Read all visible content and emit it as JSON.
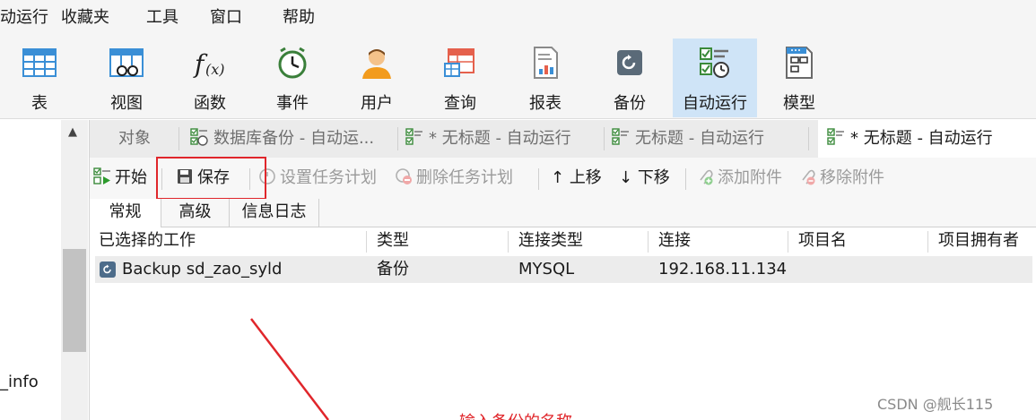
{
  "menu": [
    "动运行",
    "收藏夹",
    "工具",
    "窗口",
    "帮助"
  ],
  "toolbar": [
    {
      "label": "表",
      "icon": "table-icon"
    },
    {
      "label": "视图",
      "icon": "view-icon"
    },
    {
      "label": "函数",
      "icon": "function-icon"
    },
    {
      "label": "事件",
      "icon": "event-clock-icon"
    },
    {
      "label": "用户",
      "icon": "user-icon"
    },
    {
      "label": "查询",
      "icon": "query-icon"
    },
    {
      "label": "报表",
      "icon": "report-icon"
    },
    {
      "label": "备份",
      "icon": "backup-icon"
    },
    {
      "label": "自动运行",
      "icon": "automation-icon",
      "active": true
    },
    {
      "label": "模型",
      "icon": "model-icon"
    }
  ],
  "left_panel": {
    "text": "_info"
  },
  "tabs": [
    {
      "label": "对象"
    },
    {
      "label": "数据库备份 - 自动运..."
    },
    {
      "label": "* 无标题 - 自动运行"
    },
    {
      "label": "无标题 - 自动运行"
    },
    {
      "label": "* 无标题 - 自动运行",
      "active": true
    }
  ],
  "actions": {
    "start": "开始",
    "save": "保存",
    "set_schedule": "设置任务计划",
    "delete_schedule": "删除任务计划",
    "move_up": "上移",
    "move_down": "下移",
    "add_attachment": "添加附件",
    "remove_attachment": "移除附件"
  },
  "subtabs": [
    "常规",
    "高级",
    "信息日志"
  ],
  "table": {
    "headers": [
      "已选择的工作",
      "类型",
      "连接类型",
      "连接",
      "项目名",
      "项目拥有者"
    ],
    "rows": [
      [
        "Backup sd_zao_syld",
        "备份",
        "MYSQL",
        "192.168.11.134",
        "",
        ""
      ]
    ]
  },
  "annotation": {
    "hint": "输入备份的名称"
  },
  "watermark": "CSDN @舰长115",
  "colors": {
    "accent": "#cfe4f7",
    "annotation": "#e0262b"
  }
}
